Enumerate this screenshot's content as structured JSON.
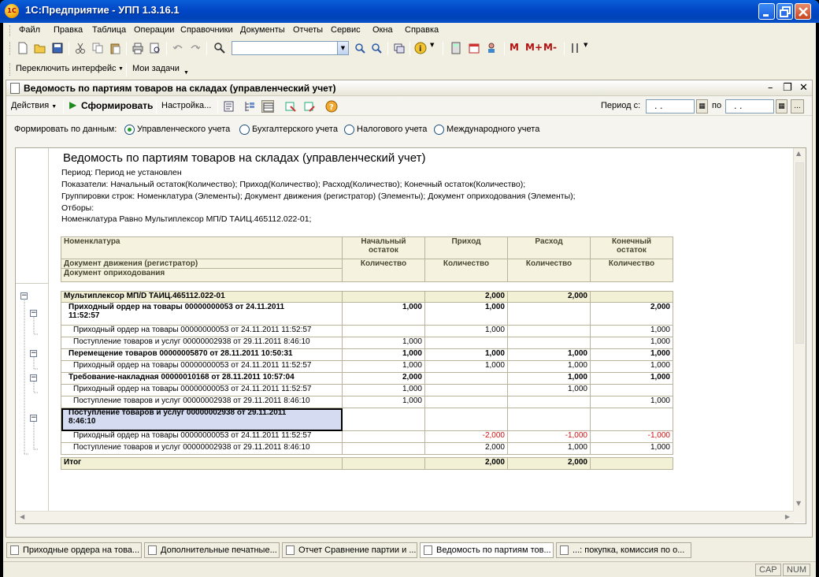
{
  "window": {
    "title": "1С:Предприятие - УПП 1.3.16.1"
  },
  "menu": [
    "Файл",
    "Правка",
    "Таблица",
    "Операции",
    "Справочники",
    "Документы",
    "Отчеты",
    "Сервис",
    "Окна",
    "Справка"
  ],
  "toolbar": {
    "calc_m": "M",
    "calc_mplus": "M+",
    "calc_mminus": "M-"
  },
  "toolbar2": {
    "switch_interface": "Переключить интерфейс",
    "my_tasks": "Мои задачи"
  },
  "document": {
    "title": "Ведомость по партиям товаров на складах (управленческий учет)",
    "actions_label": "Действия",
    "generate_label": "Сформировать",
    "settings_label": "Настройка...",
    "period_from_label": "Период с:",
    "period_to_label": "по",
    "period_from_value": ". .",
    "period_to_value": ". .",
    "period_more": "..."
  },
  "filter": {
    "label": "Формировать по данным:",
    "options": [
      "Управленческого учета",
      "Бухгалтерского учета",
      "Налогового учета",
      "Международного учета"
    ],
    "selected": "Управленческого учета"
  },
  "report": {
    "heading": "Ведомость по партиям товаров на складах (управленческий учет)",
    "lines": [
      "Период: Период не установлен",
      "Показатели: Начальный остаток(Количество); Приход(Количество); Расход(Количество); Конечный остаток(Количество);",
      "Группировки строк: Номенклатура (Элементы); Документ движения (регистратор) (Элементы); Документ оприходования (Элементы);",
      "Отборы:",
      "Номенклатура Равно Мультиплексор МП/D ТАИЦ.465112.022-01;"
    ],
    "header": {
      "col1_a": "Номенклатура",
      "col1_b": "Документ движения (регистратор)",
      "col1_c": "Документ оприходования",
      "start_1": "Начальный",
      "start_2": "остаток",
      "income": "Приход",
      "expense": "Расход",
      "end_1": "Конечный",
      "end_2": "остаток",
      "qty": "Количество"
    },
    "rows": [
      {
        "name": "Мультиплексор МП/D ТАИЦ.465112.022-01",
        "start": "",
        "income": "2,000",
        "expense": "2,000",
        "end": ""
      },
      {
        "name": "Приходный ордер на товары 00000000053 от 24.11.2011",
        "name2": "11:52:57",
        "start": "1,000",
        "income": "1,000",
        "expense": "",
        "end": "2,000"
      },
      {
        "name": "Приходный ордер на товары 00000000053 от 24.11.2011 11:52:57",
        "start": "",
        "income": "1,000",
        "expense": "",
        "end": "1,000"
      },
      {
        "name": "Поступление товаров и услуг 00000002938 от 29.11.2011 8:46:10",
        "start": "1,000",
        "income": "",
        "expense": "",
        "end": "1,000"
      },
      {
        "name": "Перемещение товаров 00000005870 от 28.11.2011 10:50:31",
        "start": "1,000",
        "income": "1,000",
        "expense": "1,000",
        "end": "1,000"
      },
      {
        "name": "Приходный ордер на товары 00000000053 от 24.11.2011 11:52:57",
        "start": "1,000",
        "income": "1,000",
        "expense": "1,000",
        "end": "1,000"
      },
      {
        "name": "Требование-накладная 00000010168 от 28.11.2011 10:57:04",
        "start": "2,000",
        "income": "",
        "expense": "1,000",
        "end": "1,000"
      },
      {
        "name": "Приходный ордер на товары 00000000053 от 24.11.2011 11:52:57",
        "start": "1,000",
        "income": "",
        "expense": "1,000",
        "end": ""
      },
      {
        "name": "Поступление товаров и услуг 00000002938 от 29.11.2011 8:46:10",
        "start": "1,000",
        "income": "",
        "expense": "",
        "end": "1,000"
      },
      {
        "name": "Поступление товаров и услуг 00000002938 от 29.11.2011",
        "name2": "8:46:10",
        "start": "",
        "income": "",
        "expense": "",
        "end": ""
      },
      {
        "name": "Приходный ордер на товары 00000000053 от 24.11.2011 11:52:57",
        "start": "",
        "income": "-2,000",
        "expense": "-1,000",
        "end": "-1,000"
      },
      {
        "name": "Поступление товаров и услуг 00000002938 от 29.11.2011 8:46:10",
        "start": "",
        "income": "2,000",
        "expense": "1,000",
        "end": "1,000"
      }
    ],
    "total": {
      "name": "Итог",
      "start": "",
      "income": "2,000",
      "expense": "2,000",
      "end": ""
    }
  },
  "tasks": [
    "Приходные ордера на това...",
    "Дополнительные печатные...",
    "Отчет  Сравнение партии и ...",
    "Ведомость по партиям тов...",
    "...: покупка, комиссия по о..."
  ],
  "status": {
    "cap": "CAP",
    "num": "NUM"
  }
}
